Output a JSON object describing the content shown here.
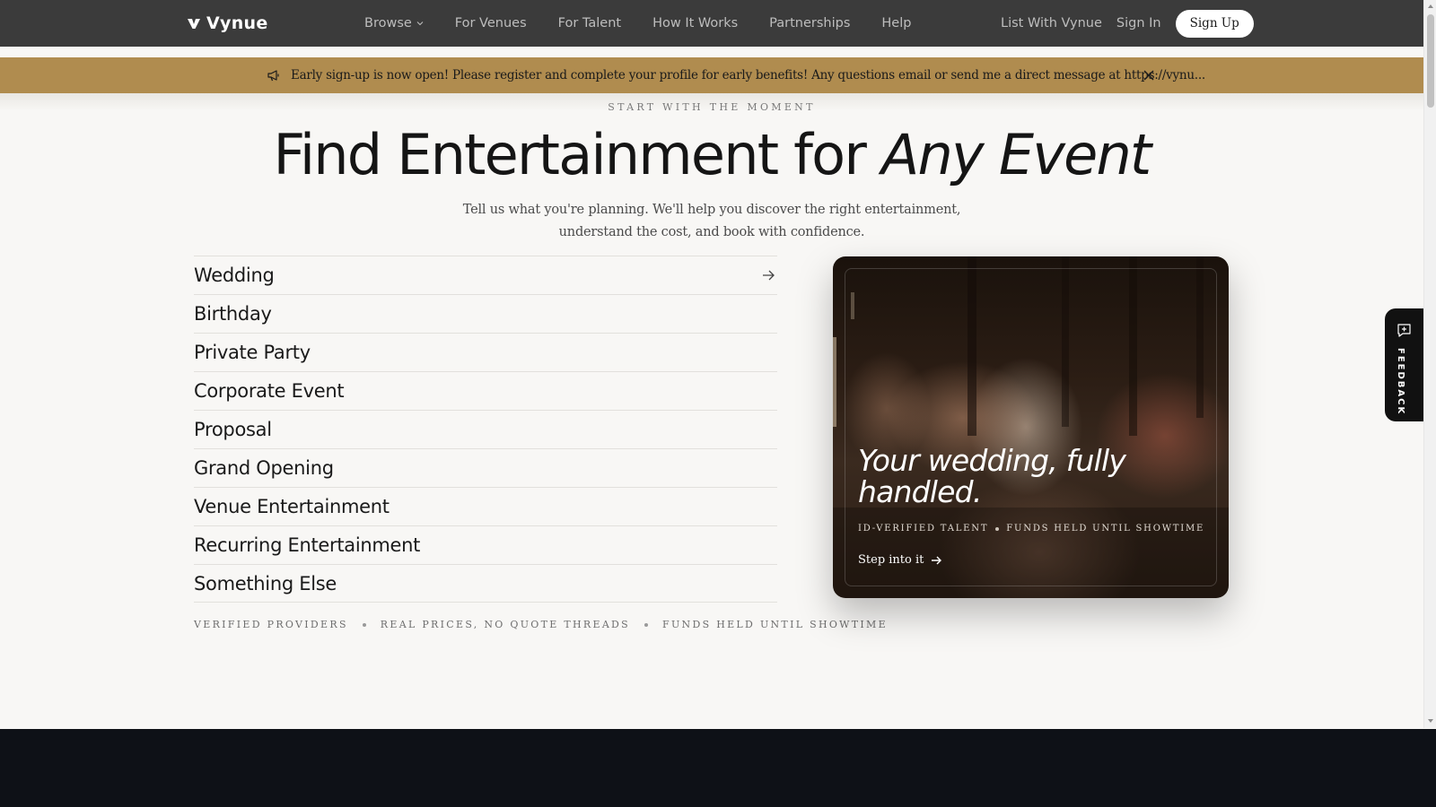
{
  "brand": {
    "name": "Vynue"
  },
  "nav": {
    "links": [
      "Browse",
      "For Venues",
      "For Talent",
      "How It Works",
      "Partnerships",
      "Help"
    ],
    "list_with": "List With Vynue",
    "sign_in": "Sign In",
    "sign_up": "Sign Up"
  },
  "banner": {
    "text": "Early sign-up is now open! Please register and complete your profile for early benefits! Any questions email or send me a direct message at https://vynu...",
    "icon": "megaphone-icon",
    "background": "#b08c4f"
  },
  "hero": {
    "eyebrow": "START WITH THE MOMENT",
    "title_plain": "Find Entertainment for ",
    "title_italic": "Any Event",
    "subtitle_line1": "Tell us what you're planning. We'll help you discover the right entertainment,",
    "subtitle_line2": "understand the cost, and book with confidence."
  },
  "events": {
    "items": [
      "Wedding",
      "Birthday",
      "Private Party",
      "Corporate Event",
      "Proposal",
      "Grand Opening",
      "Venue Entertainment",
      "Recurring Entertainment",
      "Something Else"
    ],
    "active_index": 0
  },
  "features": [
    "VERIFIED PROVIDERS",
    "REAL PRICES, NO QUOTE THREADS",
    "FUNDS HELD UNTIL SHOWTIME"
  ],
  "card": {
    "title": "Your wedding, fully handled.",
    "tags": [
      "ID-VERIFIED TALENT",
      "FUNDS HELD UNTIL SHOWTIME"
    ],
    "cta": "Step into it"
  },
  "feedback": {
    "label": "FEEDBACK"
  },
  "colors": {
    "nav_bg": "#3b3b3b",
    "footer_bg": "#0e1117",
    "page_bg": "#f8f7f5"
  }
}
